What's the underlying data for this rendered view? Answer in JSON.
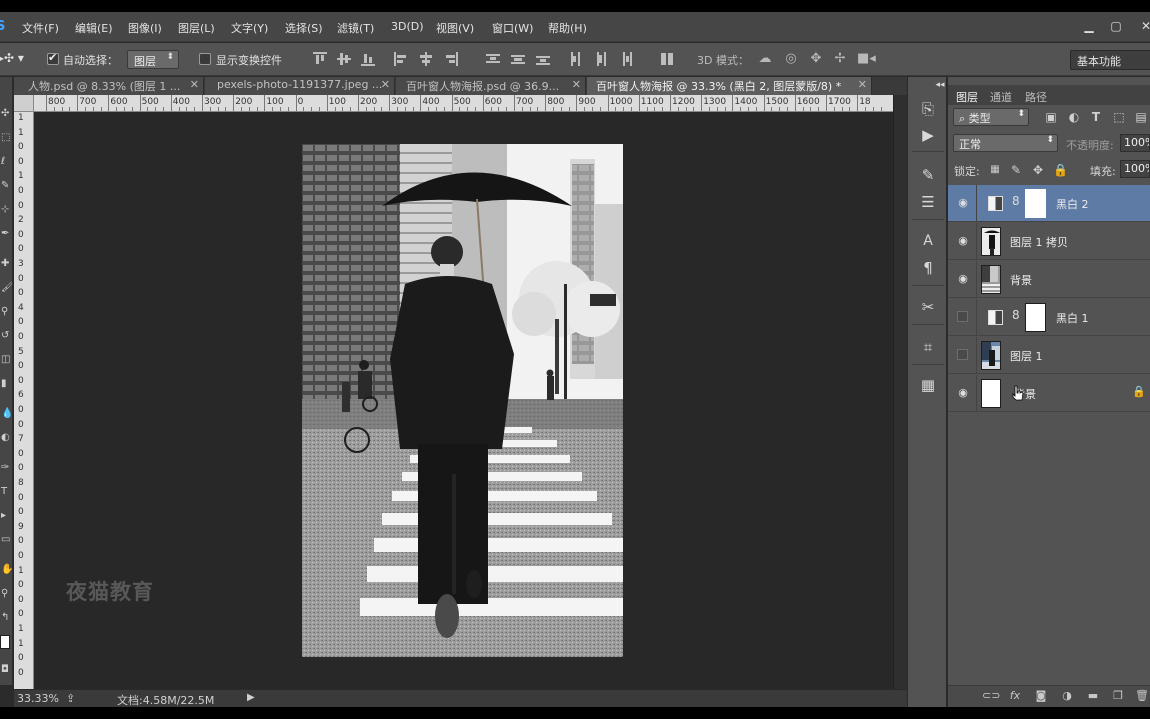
{
  "app": {
    "logo": "S",
    "menu": [
      "文件(F)",
      "编辑(E)",
      "图像(I)",
      "图层(L)",
      "文字(Y)",
      "选择(S)",
      "滤镜(T)",
      "3D(D)",
      "视图(V)",
      "窗口(W)",
      "帮助(H)"
    ],
    "window_buttons": [
      "minimize-icon",
      "maximize-icon",
      "close-icon"
    ]
  },
  "options": {
    "auto_select_label": "自动选择：",
    "auto_select_checked": true,
    "auto_select_target": "图层",
    "show_transform_label": "显示变换控件",
    "show_transform_checked": false,
    "mode3d_label": "3D 模式：",
    "workspace": "基本功能"
  },
  "tabs": [
    {
      "label": "人物.psd @ 8.33% (图层 1 ...",
      "active": false
    },
    {
      "label": "pexels-photo-1191377.jpeg ...",
      "active": false
    },
    {
      "label": "百叶窗人物海报.psd @ 36.9...",
      "active": false
    },
    {
      "label": "百叶窗人物海报 @ 33.3% (黑白 2, 图层蒙版/8) *",
      "active": true
    }
  ],
  "ruler": {
    "h_labels": [
      "800",
      "700",
      "600",
      "500",
      "400",
      "300",
      "200",
      "100",
      "0",
      "100",
      "200",
      "300",
      "400",
      "500",
      "600",
      "700",
      "800",
      "900",
      "1000",
      "1100",
      "1200",
      "1300",
      "1400",
      "1500",
      "1600",
      "1700",
      "18"
    ],
    "v_labels": [
      "1",
      "1",
      "0",
      "0",
      "1",
      "0",
      "0",
      "2",
      "0",
      "0",
      "3",
      "0",
      "0",
      "4",
      "0",
      "0",
      "5",
      "0",
      "0",
      "6",
      "0",
      "0",
      "7",
      "0",
      "0",
      "8",
      "0",
      "0",
      "9",
      "0",
      "0",
      "1",
      "0",
      "0",
      "0",
      "1",
      "1",
      "0",
      "0"
    ]
  },
  "canvas": {
    "watermark": "夜猫教育",
    "scene_colors": {
      "sky": "#f2f2f2",
      "building_dark": "#3a3a3a",
      "building_light": "#c9c9c9",
      "road": "#a5a5a5",
      "crosswalk": "#f4f4f4",
      "suit": "#1b1b1b"
    }
  },
  "status": {
    "zoom": "33.33%",
    "doc_info": "文档:4.58M/22.5M"
  },
  "layers_panel": {
    "tabs": [
      "图层",
      "通道",
      "路径"
    ],
    "filter_kind": "类型",
    "blend_mode": "正常",
    "opacity_label": "不透明度:",
    "opacity_value": "100%",
    "lock_label": "锁定:",
    "fill_label": "填充:",
    "fill_value": "100%",
    "layers": [
      {
        "name": "黑白 2",
        "visible": true,
        "type": "adjustment",
        "selected": true,
        "locked": false
      },
      {
        "name": "图层 1 拷贝",
        "visible": true,
        "type": "pixel",
        "selected": false,
        "locked": false
      },
      {
        "name": "背景",
        "visible": true,
        "type": "pixel",
        "selected": false,
        "locked": false
      },
      {
        "name": "黑白 1",
        "visible": false,
        "type": "adjustment",
        "selected": false,
        "locked": false
      },
      {
        "name": "图层 1",
        "visible": false,
        "type": "pixel",
        "selected": false,
        "locked": false
      },
      {
        "name": "背景",
        "visible": true,
        "type": "white",
        "selected": false,
        "locked": true
      }
    ],
    "footer_icons": [
      "link-icon",
      "fx-icon",
      "mask-icon",
      "adjustment-icon",
      "folder-icon",
      "new-layer-icon",
      "trash-icon"
    ]
  }
}
